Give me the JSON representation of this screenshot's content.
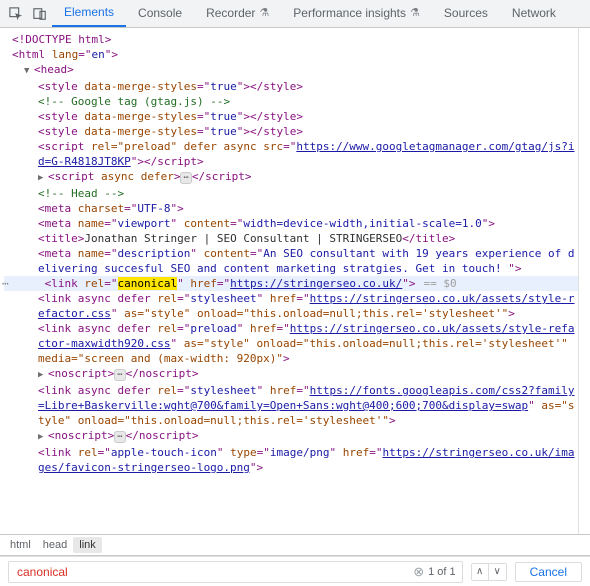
{
  "tabs": {
    "elements": "Elements",
    "console": "Console",
    "recorder": "Recorder",
    "perf": "Performance insights",
    "sources": "Sources",
    "network": "Network"
  },
  "dom": {
    "doctype": "<!DOCTYPE html>",
    "htmlOpen": {
      "tag": "html",
      "attr": "lang",
      "val": "en"
    },
    "head": "head",
    "style1": {
      "tag": "style",
      "attr": "data-merge-styles",
      "val": "true"
    },
    "gtagComment": " Google tag (gtag.js) ",
    "style2": {
      "tag": "style",
      "attr": "data-merge-styles",
      "val": "true"
    },
    "style3": {
      "tag": "style",
      "attr": "data-merge-styles",
      "val": "true"
    },
    "script1": {
      "tag": "script",
      "attrs": "rel=\"preload\" defer async",
      "srcLabel": "src",
      "src": "https://www.googletagmanager.com/gtag/js?id=G-R4818JT8KP"
    },
    "script2": {
      "tag": "script",
      "attrs": "async defer"
    },
    "headComment": " Head ",
    "metaCharset": {
      "tag": "meta",
      "attr": "charset",
      "val": "UTF-8"
    },
    "metaViewport": {
      "tag": "meta",
      "name": "viewport",
      "content": "width=device-width,initial-scale=1.0"
    },
    "title": {
      "tag": "title",
      "text": "Jonathan Stringer | SEO Consultant | STRINGERSEO"
    },
    "metaDesc": {
      "tag": "meta",
      "name": "description",
      "content": "An SEO consultant with 19 years experience of delivering succesful SEO and content marketing stratgies. Get in touch! "
    },
    "canon": {
      "tag": "link",
      "rel": "canonical",
      "href": "https://stringerseo.co.uk/",
      "eq": "== $0"
    },
    "linkStyle1": {
      "pre": "link async defer",
      "rel": "stylesheet",
      "href": "https://stringerseo.co.uk/assets/style-refactor.css",
      "post": " as=\"style\" onload=\"this.onload=null;this.rel='stylesheet'\""
    },
    "linkPreload": {
      "pre": "link async defer",
      "rel": "preload",
      "href": "https://stringerseo.co.uk/assets/style-refactor-maxwidth920.css",
      "post": " as=\"style\" onload=\"this.onload=null;this.rel='stylesheet'\" media=\"screen and (max-width: 920px)\""
    },
    "noscript1": "noscript",
    "linkFonts": {
      "pre": "link async defer",
      "rel": "stylesheet",
      "href": "https://fonts.googleapis.com/css2?family=Libre+Baskerville:wght@700&family=Open+Sans:wght@400;600;700&display=swap",
      "post": " as=\"style\" onload=\"this.onload=null;this.rel='stylesheet'\""
    },
    "noscript2": "noscript",
    "appleTouch": {
      "tag": "link",
      "rel": "apple-touch-icon",
      "type": "image/png",
      "href": "https://stringerseo.co.uk/images/favicon-stringerseo-logo.png"
    }
  },
  "breadcrumb": {
    "a": "html",
    "b": "head",
    "c": "link"
  },
  "search": {
    "value": "canonical",
    "count": "1 of 1",
    "cancel": "Cancel"
  }
}
